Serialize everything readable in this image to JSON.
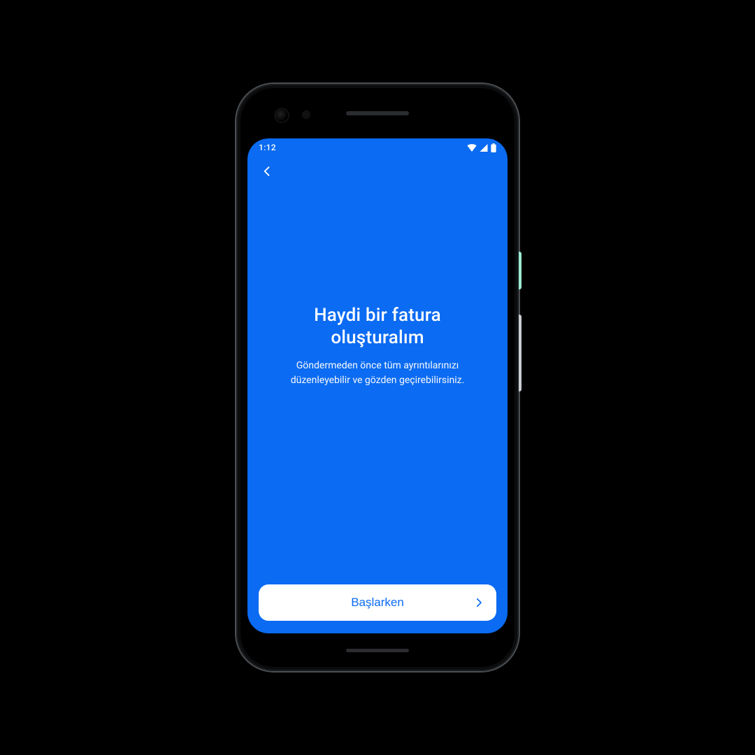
{
  "colors": {
    "accent": "#0b6bf2",
    "cta_bg": "#ffffff",
    "cta_text": "#0b6bf2"
  },
  "statusbar": {
    "time": "1:12"
  },
  "content": {
    "headline": "Haydi bir fatura oluşturalım",
    "subtext": "Göndermeden önce tüm ayrıntılarınızı düzenleyebilir ve gözden geçirebilirsiniz."
  },
  "footer": {
    "cta_label": "Başlarken"
  }
}
